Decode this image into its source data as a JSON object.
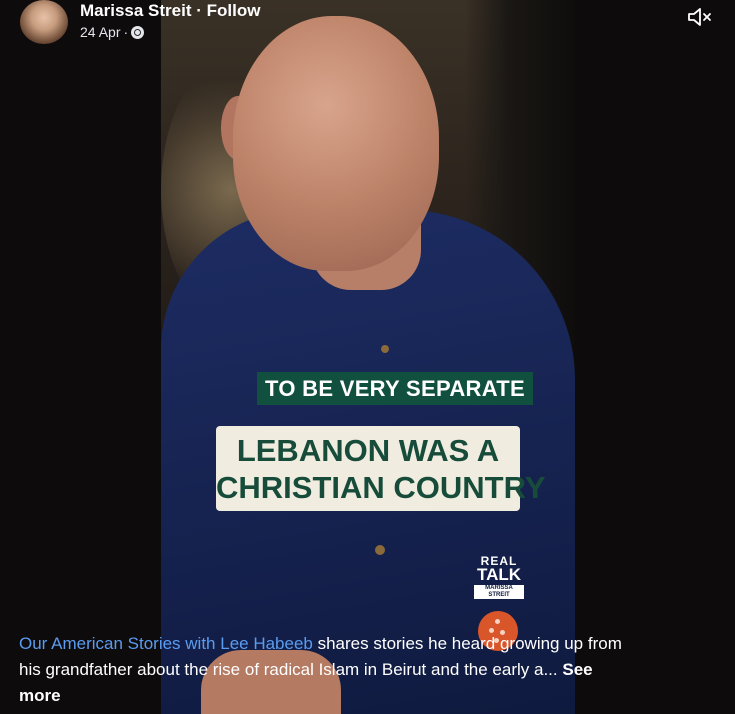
{
  "post": {
    "author": "Marissa Streit",
    "follow_label": "· Follow",
    "date": "24 Apr",
    "date_separator": "·",
    "audience_icon": "globe-icon"
  },
  "video": {
    "caption_top": "TO BE VERY SEPARATE",
    "caption_main_line1": "LEBANON WAS A",
    "caption_main_line2": "CHRISTIAN COUNTRY",
    "logo_line1": "REAL",
    "logo_line2": "TALK",
    "logo_line3": "MARISSA STREIT",
    "mute_icon": "speaker-muted-icon",
    "accent_color": "#114f3e",
    "fab_color": "#d9552a"
  },
  "description": {
    "link_text": "Our American Stories with Lee Habeeb",
    "text": " shares stories he heard growing up from his grandfather about the rise of radical Islam in Beirut and the early a...",
    "see_more": "See more"
  }
}
